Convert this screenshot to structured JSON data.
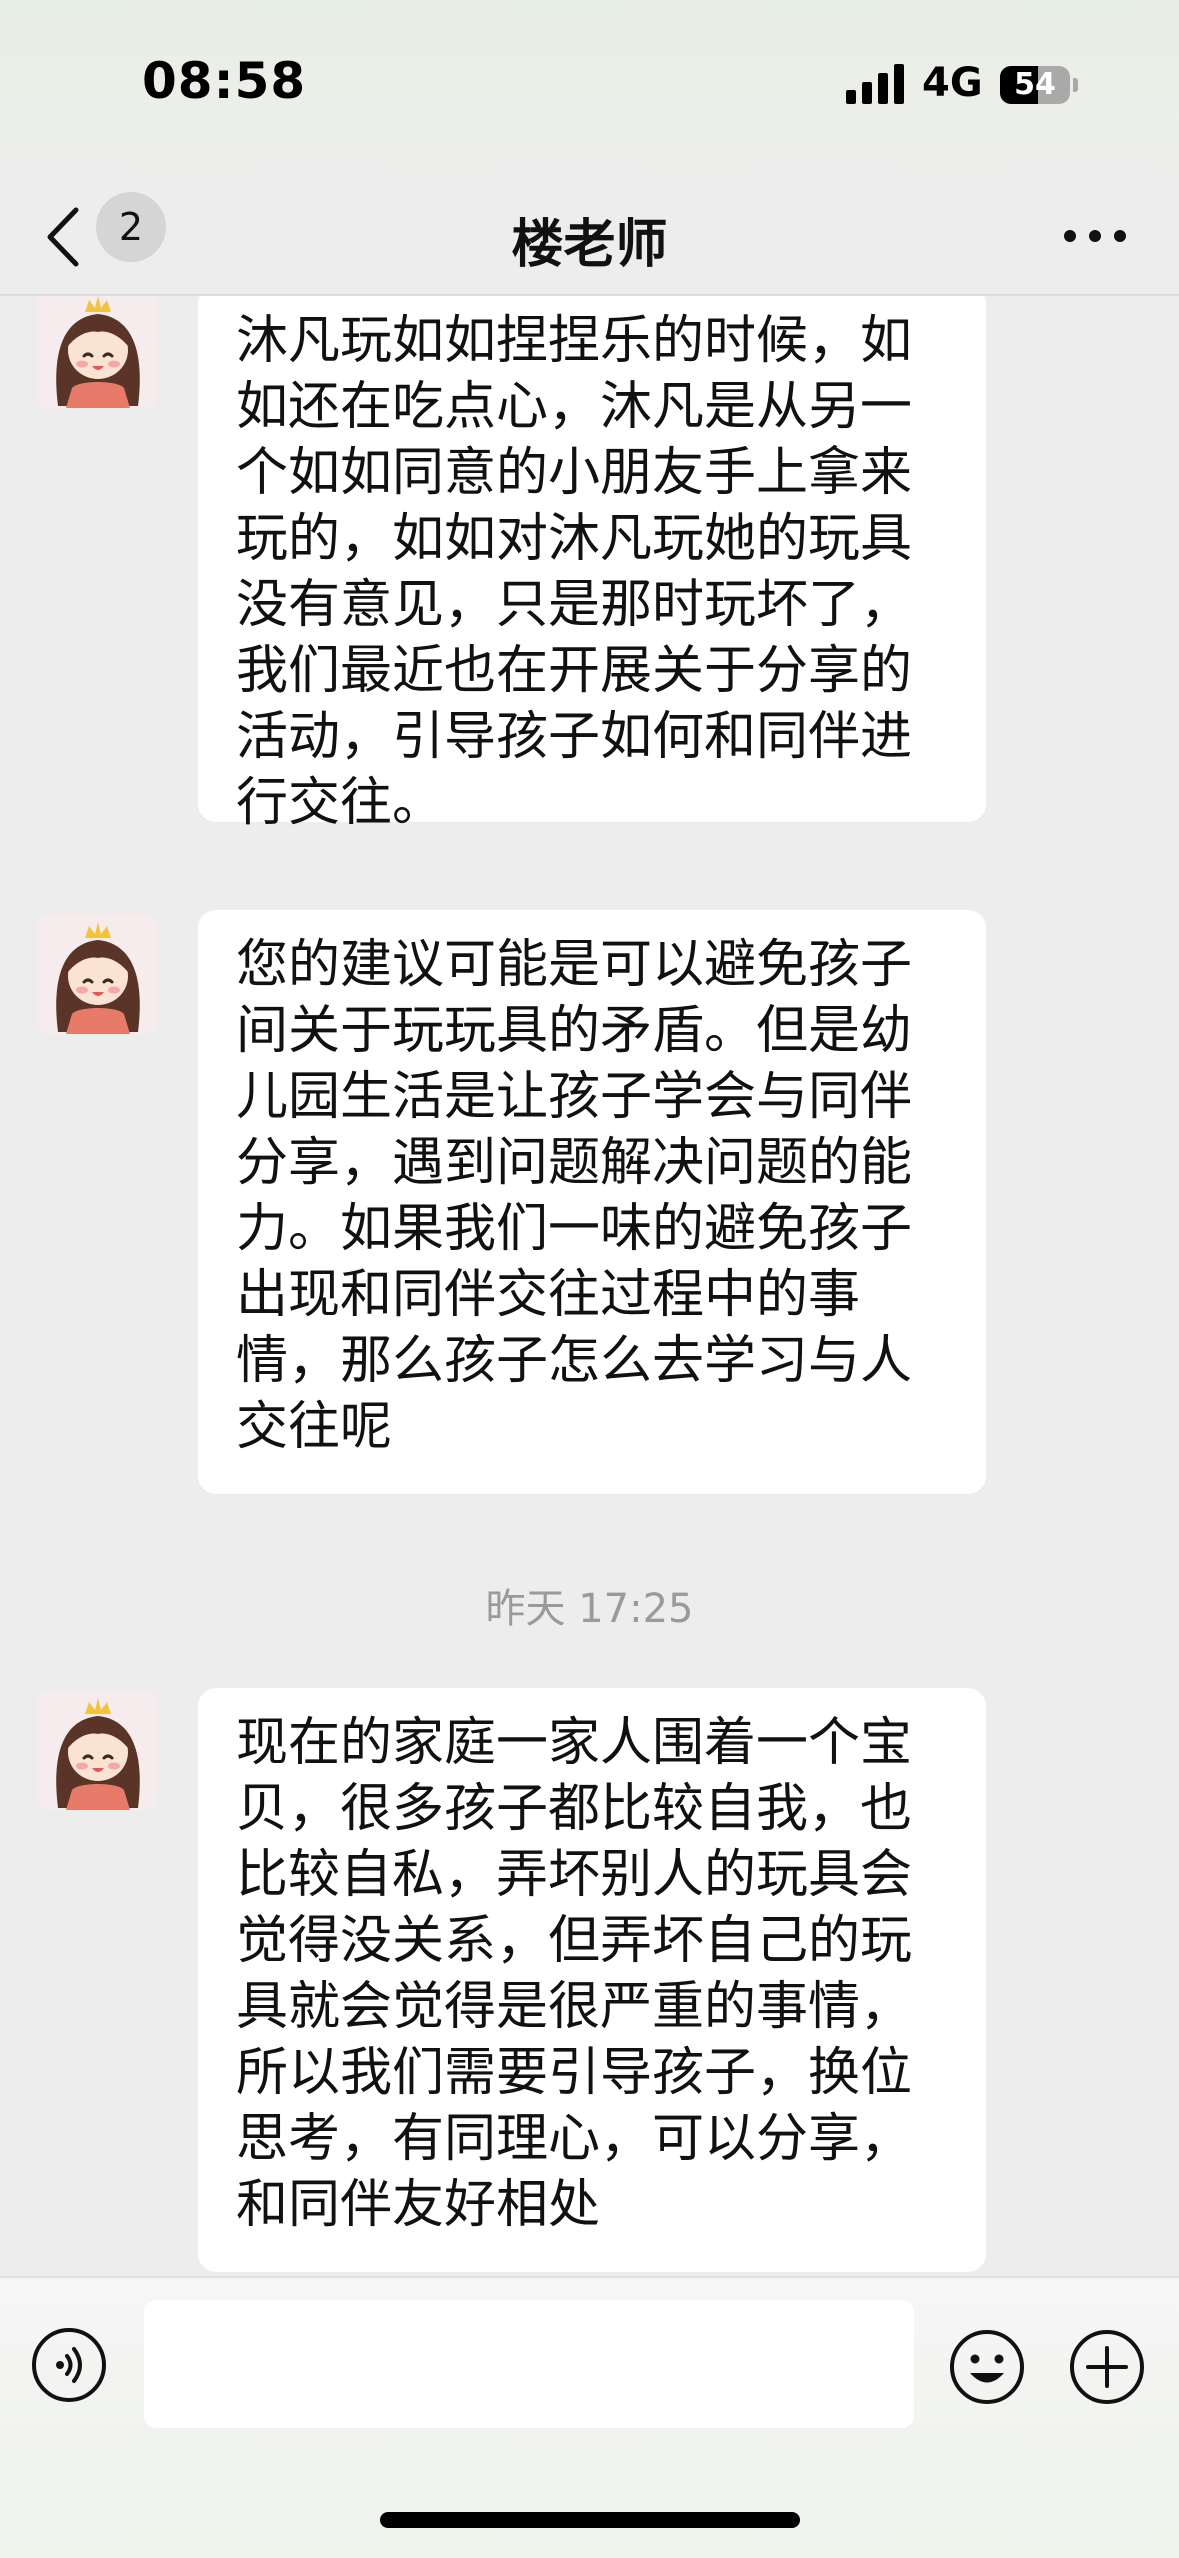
{
  "status_bar": {
    "time": "08:58",
    "network": "4G",
    "battery": "54",
    "battery_level": 0.54
  },
  "nav": {
    "unread_count": "2",
    "title": "楼老师"
  },
  "messages": [
    {
      "sender": "楼老师",
      "text": "沐凡玩如如捏捏乐的时候，如如还在吃点心，沐凡是从另一个如如同意的小朋友手上拿来玩的，如如对沐凡玩她的玩具没有意见，只是那时玩坏了，我们最近也在开展关于分享的活动，引导孩子如何和同伴进行交往。"
    },
    {
      "sender": "楼老师",
      "text": "您的建议可能是可以避免孩子间关于玩玩具的矛盾。但是幼儿园生活是让孩子学会与同伴分享，遇到问题解决问题的能力。如果我们一味的避免孩子出现和同伴交往过程中的事情，那么孩子怎么去学习与人交往呢"
    },
    {
      "sender": "楼老师",
      "text": "现在的家庭一家人围着一个宝贝，很多孩子都比较自我，也比较自私，弄坏别人的玩具会觉得没关系，但弄坏自己的玩具就会觉得是很严重的事情，所以我们需要引导孩子，换位思考，有同理心，可以分享，和同伴友好相处"
    }
  ],
  "timestamp": "昨天 17:25",
  "input": {
    "value": "",
    "placeholder": ""
  },
  "icons": {
    "back": "chevron-left-icon",
    "more": "more-dots-icon",
    "voice": "voice-icon",
    "emoji": "emoji-icon",
    "plus": "plus-icon"
  }
}
